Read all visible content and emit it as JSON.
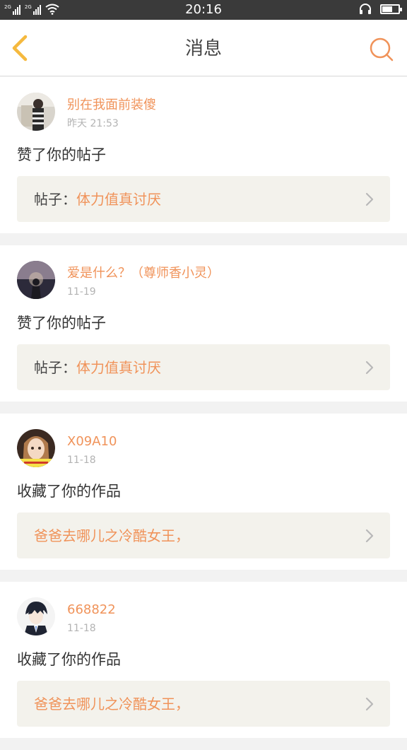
{
  "status_bar": {
    "sim1": "2G",
    "sim2": "2G",
    "time": "20:16",
    "battery_level": 0.62
  },
  "header": {
    "title": "消息"
  },
  "colors": {
    "accent": "#f0935a",
    "back_icon": "#f5b93e",
    "ref_background": "#f3f2ec"
  },
  "messages": [
    {
      "username": "别在我面前装傻",
      "time": "昨天 21:53",
      "action": "赞了你的帖子",
      "ref_prefix": "帖子：",
      "ref_title": "体力值真讨厌"
    },
    {
      "username": "爱是什么？（尊师香小灵）",
      "time": "11-19",
      "action": "赞了你的帖子",
      "ref_prefix": "帖子：",
      "ref_title": "体力值真讨厌"
    },
    {
      "username": "X09A10",
      "time": "11-18",
      "action": "收藏了你的作品",
      "ref_prefix": "",
      "ref_title": "爸爸去哪儿之冷酷女王，"
    },
    {
      "username": "668822",
      "time": "11-18",
      "action": "收藏了你的作品",
      "ref_prefix": "",
      "ref_title": "爸爸去哪儿之冷酷女王，"
    }
  ]
}
